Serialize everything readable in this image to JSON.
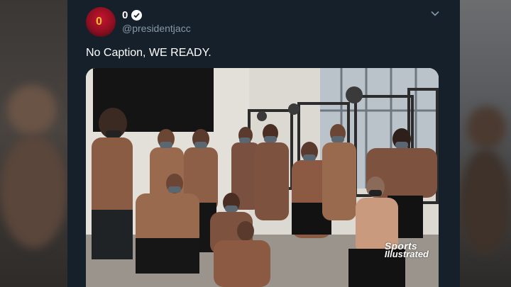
{
  "tweet": {
    "display_name": "0",
    "handle": "@presidentjacc",
    "text": "No Caption, WE READY.",
    "avatar_number": "0"
  },
  "media": {
    "watermark_line1": "Sports",
    "watermark_line2": "Illustrated"
  },
  "icons": {
    "verified": "verified-badge-icon",
    "more": "chevron-down-icon"
  },
  "colors": {
    "card_bg": "#15202b",
    "handle": "#8899a6",
    "text": "#ffffff"
  }
}
